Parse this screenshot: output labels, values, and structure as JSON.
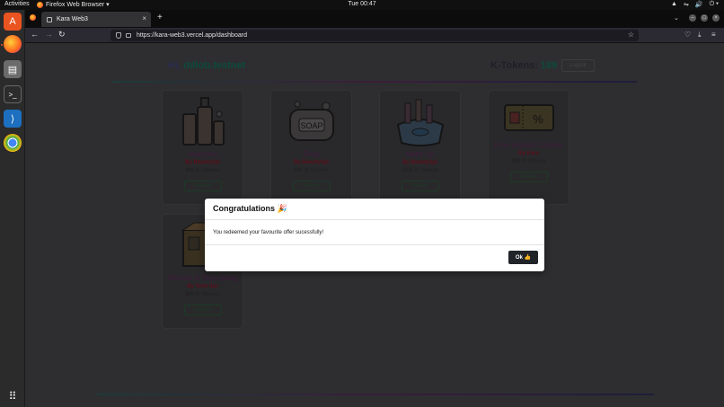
{
  "topbar": {
    "activities": "Activities",
    "app_menu": "Firefox Web Browser ▾",
    "clock": "Tue 00:47",
    "tray": [
      "▲",
      "⇋",
      "🔊",
      "⏻ ▾"
    ]
  },
  "browser": {
    "tab_title": "Kara Web3",
    "tab_close": "×",
    "new_tab": "+",
    "list_tabs": "⌄",
    "back": "←",
    "forward": "→",
    "reload": "↻",
    "url": "https://kara-web3.vercel.app/dashboard",
    "star": "☆",
    "pocket": "♡",
    "download": "⤓",
    "menu": "≡",
    "min": "–",
    "max": "□",
    "close": "×"
  },
  "page": {
    "greeting_prefix": "Hi,",
    "username": "ddlob.testnet",
    "ktokens_label": "K-Tokens:",
    "ktokens_value": "189",
    "logout_label": "Logout",
    "offers": [
      {
        "name": "shampoo",
        "by": "By BeautySpi",
        "price": "800 K-Tokens",
        "button": "Redeem",
        "icon": "shampoo-bottles-icon"
      },
      {
        "name": "Soap",
        "by": "By BeautySpi",
        "price": "600 K-Tokens",
        "button": "Redeem",
        "icon": "soap-bar-icon"
      },
      {
        "name": "Make Up",
        "by": "By BeautySpi",
        "price": "1000 K-Tokens",
        "button": "Redeem",
        "icon": "makeup-kit-icon"
      },
      {
        "name": "Free session Copons",
        "by": "By Kara",
        "price": "800 K-Tokens",
        "button": "Redeem",
        "icon": "coupon-ticket-icon"
      },
      {
        "name": "Women In Tech Swag",
        "by": "By Tech Xpr",
        "price": "800 K-Tokens",
        "button": "Redeem",
        "icon": "swag-box-icon"
      }
    ]
  },
  "modal": {
    "title": "Congratulations 🎉",
    "message": "You redeemed your favourite offer sucessfully!",
    "ok_label": "Ok 👍"
  },
  "colors": {
    "accent": "#e95420",
    "modal_button": "#212529"
  }
}
